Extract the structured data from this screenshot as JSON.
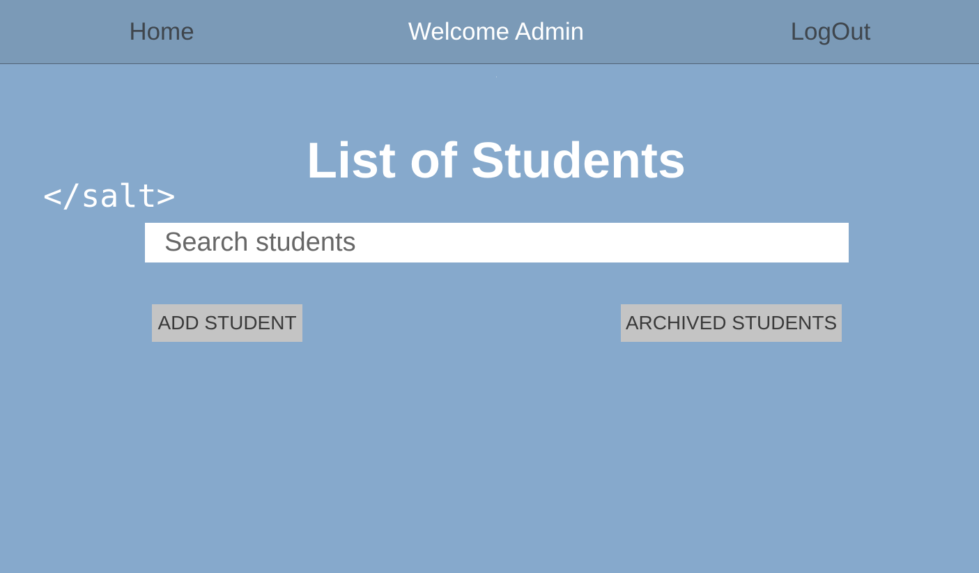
{
  "nav": {
    "home_label": "Home",
    "welcome_text": "Welcome Admin",
    "logout_label": "LogOut"
  },
  "logo": {
    "text": "</salt>"
  },
  "main": {
    "title": "List of Students",
    "search": {
      "placeholder": "Search students",
      "value": ""
    },
    "add_button_label": "ADD STUDENT",
    "archived_button_label": "ARCHIVED STUDENTS"
  },
  "colors": {
    "background": "#86a9cc",
    "navbar": "#7b9ab7",
    "button": "#c4c4c4",
    "title_text": "#ffffff"
  }
}
